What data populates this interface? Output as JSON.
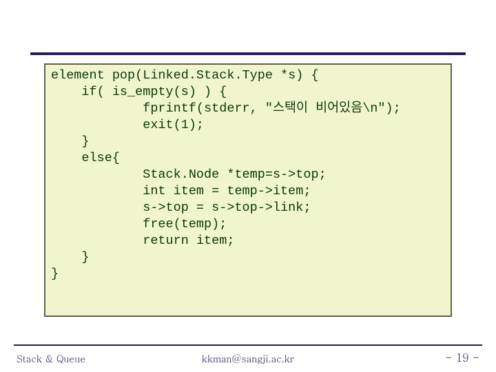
{
  "code": "element pop(Linked.Stack.Type *s) {\n    if( is_empty(s) ) {\n            fprintf(stderr, \"스택이 비어있음\\n\");\n            exit(1);\n    }\n    else{\n            Stack.Node *temp=s->top;\n            int item = temp->item;\n            s->top = s->top->link;\n            free(temp);\n            return item;\n    }\n}",
  "footer": {
    "left": "Stack & Queue",
    "center": "kkman@sangji.ac.kr",
    "right": "- 19 -"
  }
}
